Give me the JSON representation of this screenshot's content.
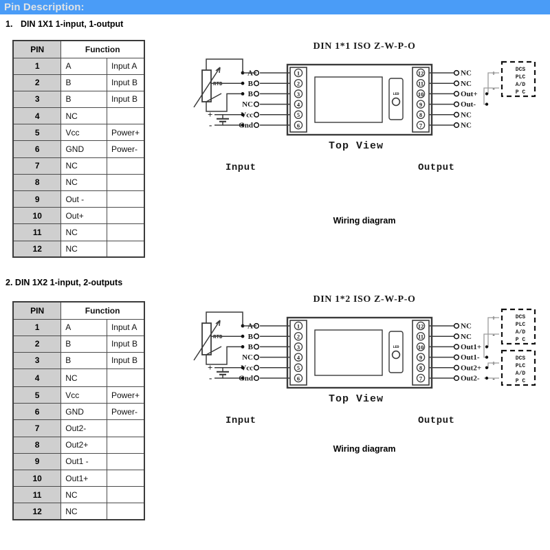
{
  "banner": {
    "title": "Pin Description:"
  },
  "sections": [
    {
      "number": "1.",
      "title": "DIN 1X1 1-input, 1-output"
    },
    {
      "number": "2.",
      "title": "DIN 1X2 1-input, 2-outputs"
    }
  ],
  "table_headers": {
    "pin": "PIN",
    "function": "Function"
  },
  "table1": {
    "rows": [
      {
        "pin": "1",
        "fn": "A",
        "note": "Input A"
      },
      {
        "pin": "2",
        "fn": "B",
        "note": "Input B"
      },
      {
        "pin": "3",
        "fn": "B",
        "note": "Input B"
      },
      {
        "pin": "4",
        "fn": "NC",
        "note": ""
      },
      {
        "pin": "5",
        "fn": "Vcc",
        "note": "Power+"
      },
      {
        "pin": "6",
        "fn": "GND",
        "note": "Power-"
      },
      {
        "pin": "7",
        "fn": "NC",
        "note": ""
      },
      {
        "pin": "8",
        "fn": "NC",
        "note": ""
      },
      {
        "pin": "9",
        "fn": "Out -",
        "note": ""
      },
      {
        "pin": "10",
        "fn": "Out+",
        "note": ""
      },
      {
        "pin": "11",
        "fn": "NC",
        "note": ""
      },
      {
        "pin": "12",
        "fn": "NC",
        "note": ""
      }
    ]
  },
  "table2": {
    "rows": [
      {
        "pin": "1",
        "fn": "A",
        "note": "Input A"
      },
      {
        "pin": "2",
        "fn": "B",
        "note": "Input B"
      },
      {
        "pin": "3",
        "fn": "B",
        "note": "Input B"
      },
      {
        "pin": "4",
        "fn": "NC",
        "note": ""
      },
      {
        "pin": "5",
        "fn": "Vcc",
        "note": "Power+"
      },
      {
        "pin": "6",
        "fn": "GND",
        "note": "Power-"
      },
      {
        "pin": "7",
        "fn": "Out2-",
        "note": ""
      },
      {
        "pin": "8",
        "fn": "Out2+",
        "note": ""
      },
      {
        "pin": "9",
        "fn": "Out1 -",
        "note": ""
      },
      {
        "pin": "10",
        "fn": "Out1+",
        "note": ""
      },
      {
        "pin": "11",
        "fn": "NC",
        "note": ""
      },
      {
        "pin": "12",
        "fn": "NC",
        "note": ""
      }
    ]
  },
  "diagram1": {
    "title": "DIN 1*1 ISO Z-W-P-O",
    "top_view_label": "Top View",
    "input_label": "Input",
    "output_label": "Output",
    "caption": "Wiring diagram",
    "sensor_label": "RTD",
    "led_label": "LED",
    "left_pins": [
      {
        "num": "1",
        "label": "A"
      },
      {
        "num": "2",
        "label": "B"
      },
      {
        "num": "3",
        "label": "B"
      },
      {
        "num": "4",
        "label": "NC"
      },
      {
        "num": "5",
        "label": "Vcc"
      },
      {
        "num": "6",
        "label": "Gnd"
      }
    ],
    "right_pins": [
      {
        "num": "12",
        "label": "NC"
      },
      {
        "num": "11",
        "label": "NC"
      },
      {
        "num": "10",
        "label": "Out+"
      },
      {
        "num": "9",
        "label": "Out-"
      },
      {
        "num": "8",
        "label": "NC"
      },
      {
        "num": "7",
        "label": "NC"
      }
    ],
    "supply_plus": "+",
    "supply_minus": "-",
    "load_boxes": [
      {
        "lines": [
          "DCS",
          "PLC",
          "A/D",
          "P  C"
        ],
        "plus": "+",
        "minus": "-"
      }
    ]
  },
  "diagram2": {
    "title": "DIN 1*2 ISO Z-W-P-O",
    "top_view_label": "Top View",
    "input_label": "Input",
    "output_label": "Output",
    "caption": "Wiring diagram",
    "sensor_label": "RTD",
    "led_label": "LED",
    "left_pins": [
      {
        "num": "1",
        "label": "A"
      },
      {
        "num": "2",
        "label": "B"
      },
      {
        "num": "3",
        "label": "B"
      },
      {
        "num": "4",
        "label": "NC"
      },
      {
        "num": "5",
        "label": "Vcc"
      },
      {
        "num": "6",
        "label": "Gnd"
      }
    ],
    "right_pins": [
      {
        "num": "12",
        "label": "NC"
      },
      {
        "num": "11",
        "label": "NC"
      },
      {
        "num": "10",
        "label": "Out1+"
      },
      {
        "num": "9",
        "label": "Out1-"
      },
      {
        "num": "8",
        "label": "Out2+"
      },
      {
        "num": "7",
        "label": "Out2-"
      }
    ],
    "supply_plus": "+",
    "supply_minus": "-",
    "load_boxes": [
      {
        "lines": [
          "DCS",
          "PLC",
          "A/D",
          "P  C"
        ],
        "plus": "+",
        "minus": "-"
      },
      {
        "lines": [
          "DCS",
          "PLC",
          "A/D",
          "P  C"
        ],
        "plus": "+",
        "minus": "-"
      }
    ]
  },
  "colors": {
    "banner_blue": "#4a9cf7",
    "banner_text": "#dfe3e6",
    "table_header_gray": "#cfcfcf",
    "line": "#3a3a3a"
  }
}
